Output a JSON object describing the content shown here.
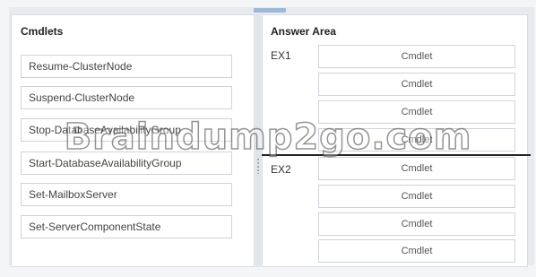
{
  "cmdlets_panel": {
    "title": "Cmdlets",
    "items": [
      "Resume-ClusterNode",
      "Suspend-ClusterNode",
      "Stop-DatabaseAvailabilityGroup",
      "Start-DatabaseAvailabilityGroup",
      "Set-MailboxServer",
      "Set-ServerComponentState"
    ]
  },
  "answer_area": {
    "title": "Answer Area",
    "groups": [
      {
        "label": "EX1",
        "slots": [
          "Cmdlet",
          "Cmdlet",
          "Cmdlet",
          "Cmdlet"
        ]
      },
      {
        "label": "EX2",
        "slots": [
          "Cmdlet",
          "Cmdlet",
          "Cmdlet",
          "Cmdlet"
        ]
      }
    ]
  },
  "watermark": "Braindump2go.com"
}
